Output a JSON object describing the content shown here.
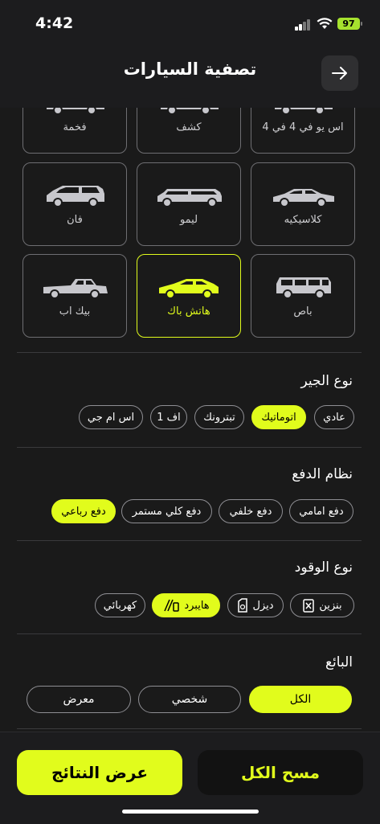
{
  "status": {
    "time": "4:42",
    "battery": "97"
  },
  "header": {
    "title": "تصفية السيارات"
  },
  "car_types": [
    {
      "label": "فخمة",
      "selected": false
    },
    {
      "label": "كشف",
      "selected": false
    },
    {
      "label": "اس يو في 4 في 4",
      "selected": false
    },
    {
      "label": "فان",
      "selected": false
    },
    {
      "label": "ليمو",
      "selected": false
    },
    {
      "label": "كلاسيكيه",
      "selected": false
    },
    {
      "label": "بيك اب",
      "selected": false
    },
    {
      "label": "هاتش باك",
      "selected": true
    },
    {
      "label": "باص",
      "selected": false
    }
  ],
  "gearbox": {
    "title": "نوع الجير",
    "options": [
      "عادي",
      "اتوماتيك",
      "تبترونك",
      "اف 1",
      "اس ام جي"
    ],
    "selected": "اتوماتيك"
  },
  "drive": {
    "title": "نظام الدفع",
    "options": [
      "دفع امامي",
      "دفع خلفي",
      "دفع كلي مستمر",
      "دفع رباعي"
    ],
    "selected": "دفع رباعي"
  },
  "fuel": {
    "title": "نوع الوقود",
    "options": [
      "بنزين",
      "ديزل",
      "هايبرد",
      "كهربائي"
    ],
    "selected": "هايبرد"
  },
  "seller": {
    "title": "البائع",
    "options": [
      "الكل",
      "شخصي",
      "معرض"
    ],
    "selected": "الكل"
  },
  "footer": {
    "clear_label": "مسح الكل",
    "show_label": "عرض النتائج"
  },
  "colors": {
    "accent": "#e1fc1c",
    "background": "#1a1a1a",
    "border": "#6e6e72"
  }
}
